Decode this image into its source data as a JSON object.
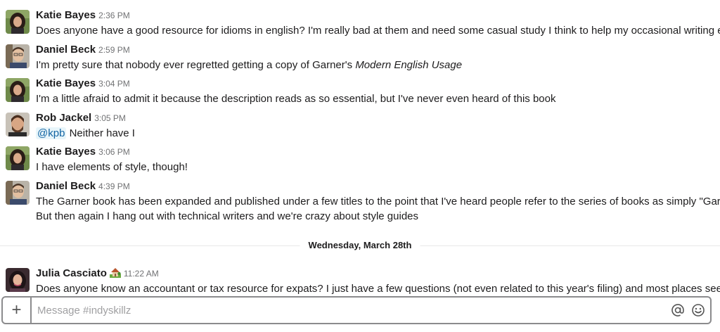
{
  "channel": "indyskillz",
  "messages": [
    {
      "sender": "Katie Bayes",
      "time": "2:36 PM",
      "text": "Does anyone have a good resource for idioms in english? I'm really bad at them and need some casual study I think to help my occasional writing efforts"
    },
    {
      "sender": "Daniel Beck",
      "time": "2:59 PM",
      "text": "I'm pretty sure that nobody ever regretted getting a copy of Garner's ",
      "emphasis": "Modern English Usage"
    },
    {
      "sender": "Katie Bayes",
      "time": "3:04 PM",
      "text": "I'm a little afraid to admit it because the description reads as so essential, but I've never even heard of this book"
    },
    {
      "sender": "Rob Jackel",
      "time": "3:05 PM",
      "mention": "@kpb",
      "text": " Neither have I"
    },
    {
      "sender": "Katie Bayes",
      "time": "3:06 PM",
      "text": "I have elements of style, though!"
    },
    {
      "sender": "Daniel Beck",
      "time": "4:39 PM",
      "text": "The Garner book has been expanded and published under a few titles to the point that I've heard people refer to the series of books as simply \"Garner\".",
      "text2": "But then again I hang out with technical writers and we're crazy about style guides"
    },
    {
      "sender": "Julia Casciato",
      "time": "11:22 AM",
      "status_icon": "house-with-garden-icon",
      "text": "Does anyone know an accountant or tax resource for expats? I just have a few questions (not even related to this year's filing) and most places seem to"
    }
  ],
  "date_divider": "Wednesday, March 28th",
  "composer": {
    "placeholder": "Message #indyskillz",
    "plus_label": "+",
    "mention_icon": "at-sign-icon",
    "emoji_icon": "smiley-icon"
  },
  "colors": {
    "mention_bg": "#e8f5fa",
    "mention_fg": "#1264a3",
    "timestamp": "#717274",
    "border": "#8b8b8d"
  }
}
